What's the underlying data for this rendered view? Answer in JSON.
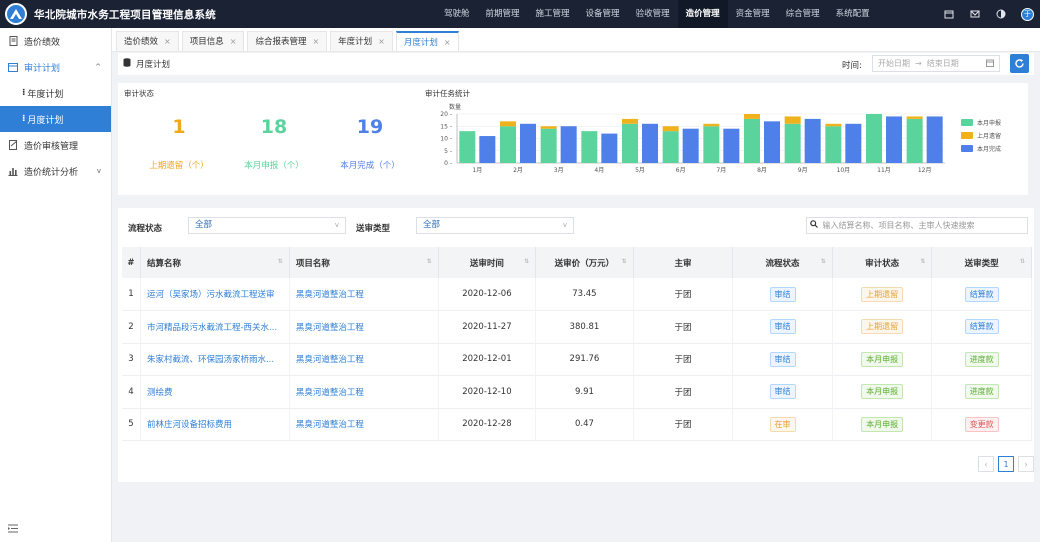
{
  "app": {
    "title": "华北院城市水务工程项目管理信息系统"
  },
  "topnav": [
    "驾驶舱",
    "前期管理",
    "施工管理",
    "设备管理",
    "验收管理",
    "造价管理",
    "资金管理",
    "综合管理",
    "系统配置"
  ],
  "topnav_active": "造价管理",
  "sidebar": {
    "items": [
      {
        "label": "造价绩效"
      },
      {
        "label": "审计计划"
      },
      {
        "label": "年度计划"
      },
      {
        "label": "月度计划"
      },
      {
        "label": "造价审核管理"
      },
      {
        "label": "造价统计分析"
      }
    ]
  },
  "tabs": [
    {
      "label": "造价绩效"
    },
    {
      "label": "项目信息"
    },
    {
      "label": "综合报表管理"
    },
    {
      "label": "年度计划"
    },
    {
      "label": "月度计划"
    }
  ],
  "header": {
    "title": "月度计划",
    "time_label": "时间:",
    "start_placeholder": "开始日期",
    "sep": "→",
    "end_placeholder": "结束日期"
  },
  "stats": {
    "title": "审计状态",
    "items": [
      {
        "value": "1",
        "label": "上期遗留（个）",
        "color": "#f0a81e"
      },
      {
        "value": "18",
        "label": "本月申报（个）",
        "color": "#5bd39d"
      },
      {
        "value": "19",
        "label": "本月完成（个）",
        "color": "#4f7fe8"
      }
    ]
  },
  "chart_title": "审计任务统计",
  "chart_data": {
    "type": "bar",
    "ylabel": "数量",
    "ylim": [
      0,
      20
    ],
    "yticks": [
      0,
      5,
      10,
      15,
      20
    ],
    "categories": [
      "1月",
      "2月",
      "3月",
      "4月",
      "5月",
      "6月",
      "7月",
      "8月",
      "9月",
      "10月",
      "11月",
      "12月"
    ],
    "series": [
      {
        "name": "本月申报",
        "stack": "a",
        "color": "#5bd39d",
        "values": [
          13,
          15,
          14,
          13,
          16,
          13,
          15,
          18,
          16,
          15,
          20,
          18
        ]
      },
      {
        "name": "上月遗留",
        "stack": "a",
        "color": "#f0b21c",
        "values": [
          0,
          2,
          1,
          0,
          2,
          2,
          1,
          2,
          3,
          1,
          0,
          1
        ]
      },
      {
        "name": "本月完成",
        "stack": "b",
        "color": "#4f7fe8",
        "values": [
          11,
          16,
          15,
          12,
          16,
          14,
          14,
          17,
          18,
          16,
          19,
          19
        ]
      }
    ],
    "legend": "right"
  },
  "filters": {
    "flow_label": "流程状态",
    "flow_value": "全部",
    "type_label": "送审类型",
    "type_value": "全部",
    "search_placeholder": "输入结算名称、项目名称、主审人快速搜索"
  },
  "table": {
    "headers": [
      "#",
      "结算名称",
      "项目名称",
      "送审时间",
      "送审价（万元）",
      "主审",
      "流程状态",
      "审计状态",
      "送审类型"
    ],
    "rows": [
      {
        "no": "1",
        "name": "运河（吴家场）污水截流工程送审",
        "project": "黑臭河道整治工程",
        "date": "2020-12-06",
        "price": "73.45",
        "auditor": "于团",
        "flow": "审结",
        "flow_c": "blue",
        "audit": "上期遗留",
        "audit_c": "orange",
        "type": "结算款",
        "type_c": "blue"
      },
      {
        "no": "2",
        "name": "市河精品段污水截流工程-西关水...",
        "project": "黑臭河道整治工程",
        "date": "2020-11-27",
        "price": "380.81",
        "auditor": "于团",
        "flow": "审结",
        "flow_c": "blue",
        "audit": "上期遗留",
        "audit_c": "orange",
        "type": "结算款",
        "type_c": "blue"
      },
      {
        "no": "3",
        "name": "朱家村截流、环保园汤家桥雨水...",
        "project": "黑臭河道整治工程",
        "date": "2020-12-01",
        "price": "291.76",
        "auditor": "于团",
        "flow": "审结",
        "flow_c": "blue",
        "audit": "本月申报",
        "audit_c": "green",
        "type": "进度款",
        "type_c": "green"
      },
      {
        "no": "4",
        "name": "测绘费",
        "project": "黑臭河道整治工程",
        "date": "2020-12-10",
        "price": "9.91",
        "auditor": "于团",
        "flow": "审结",
        "flow_c": "blue",
        "audit": "本月申报",
        "audit_c": "green",
        "type": "进度款",
        "type_c": "green"
      },
      {
        "no": "5",
        "name": "前林庄河设备招标费用",
        "project": "黑臭河道整治工程",
        "date": "2020-12-28",
        "price": "0.47",
        "auditor": "于团",
        "flow": "在审",
        "flow_c": "orange",
        "audit": "本月申报",
        "audit_c": "green",
        "type": "变更款",
        "type_c": "red"
      }
    ]
  },
  "pager": {
    "current": "1",
    "prev": "‹",
    "next": "›"
  }
}
